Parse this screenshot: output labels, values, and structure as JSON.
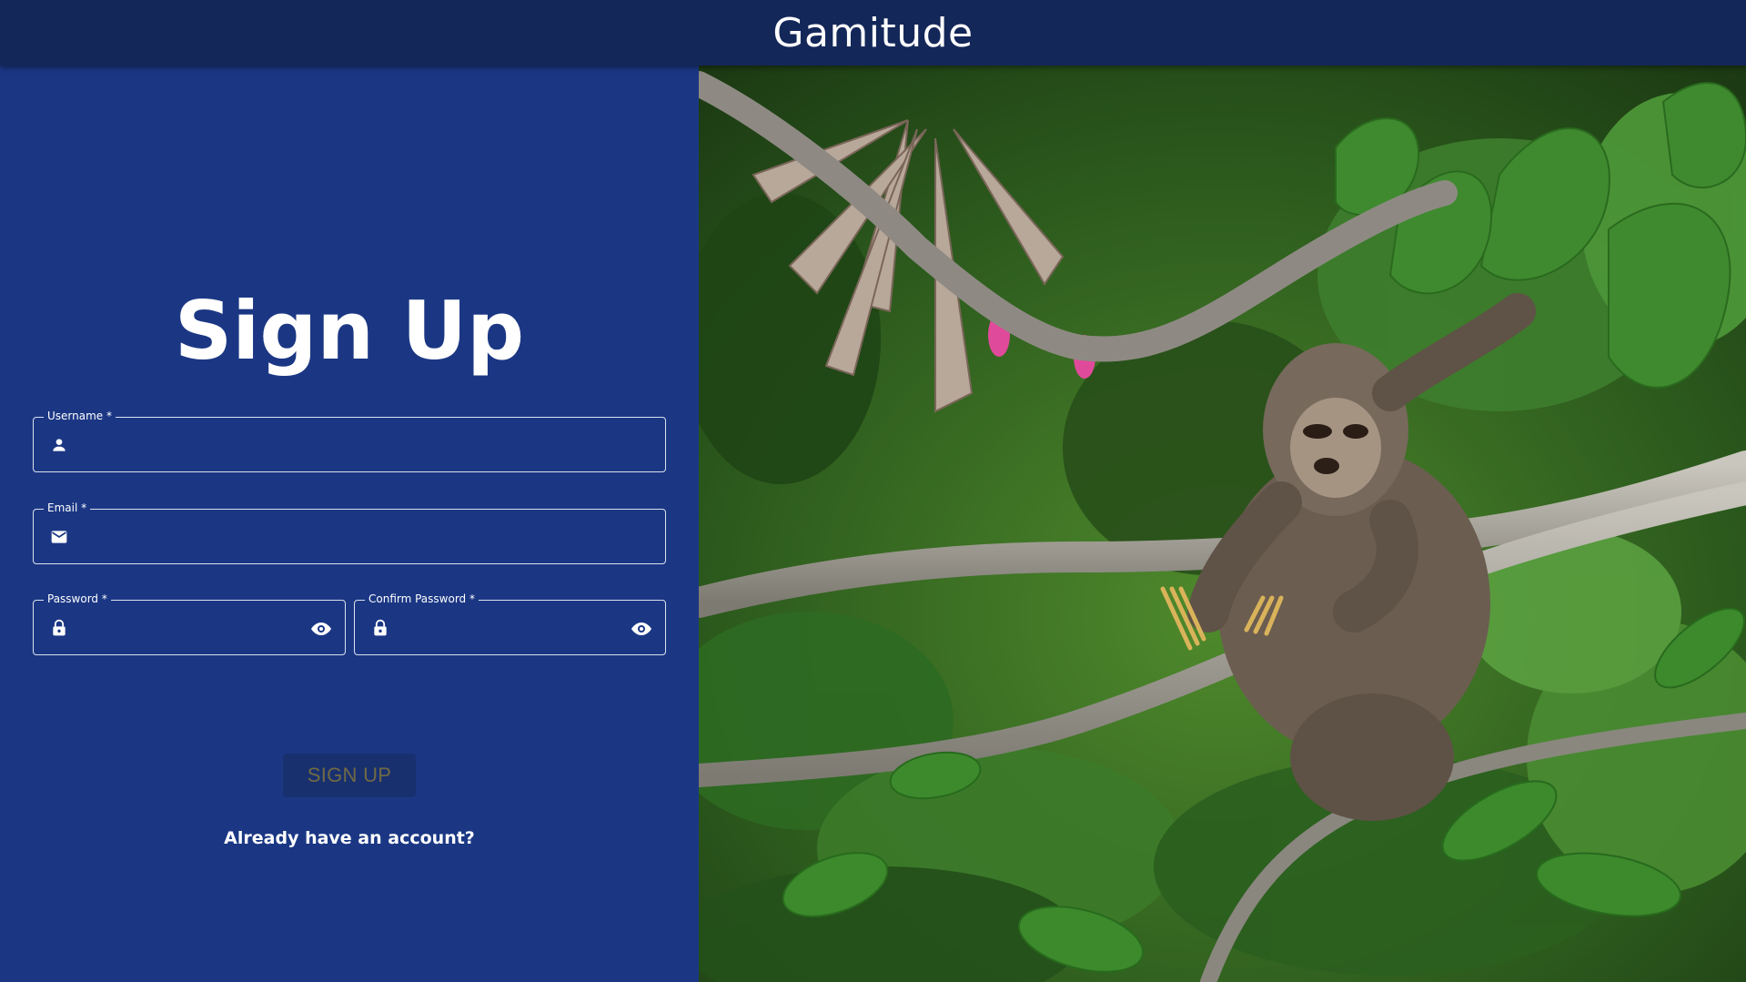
{
  "app_bar": {
    "title": "Gamitude"
  },
  "form": {
    "heading": "Sign Up",
    "username": {
      "label": "Username *",
      "value": "",
      "icon": "person-icon"
    },
    "email": {
      "label": "Email *",
      "value": "",
      "icon": "mail-icon"
    },
    "password": {
      "label": "Password *",
      "value": "",
      "icon": "lock-icon",
      "toggle_icon": "eye-icon"
    },
    "confirm_password": {
      "label": "Confirm Password *",
      "value": "",
      "icon": "lock-icon",
      "toggle_icon": "eye-icon"
    },
    "submit_label": "SIGN UP",
    "login_link": "Already have an account?"
  },
  "colors": {
    "app_bar": "#142759",
    "panel": "#1b3784",
    "button_bg": "#19306f",
    "button_text": "#706a44"
  }
}
